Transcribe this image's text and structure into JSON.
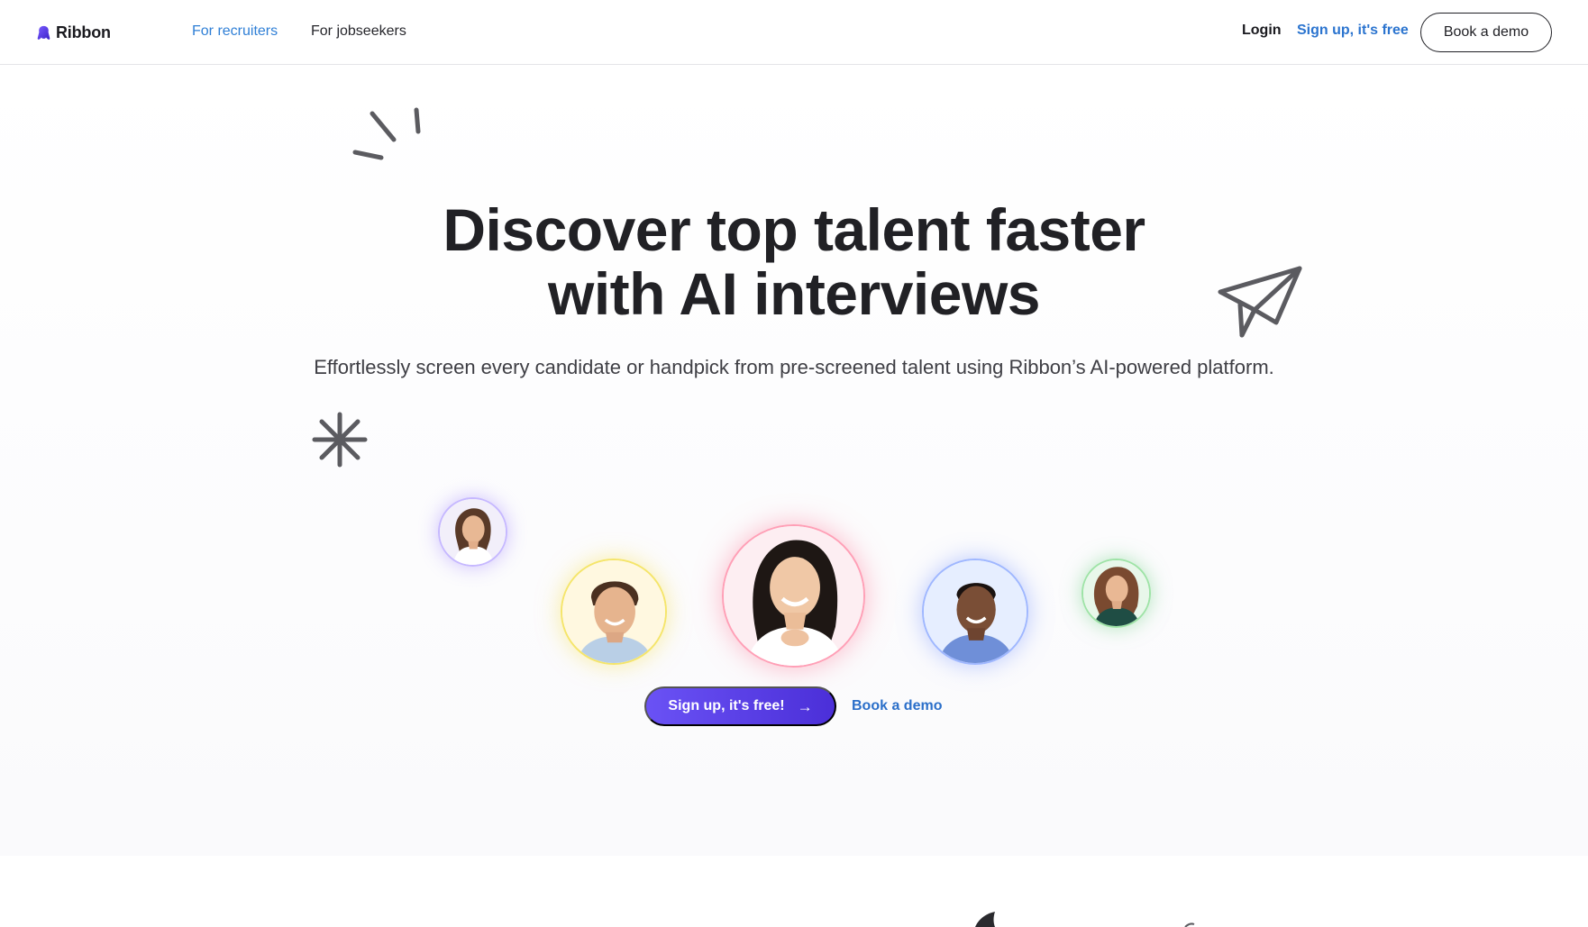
{
  "nav": {
    "brand": "Ribbon",
    "links": [
      {
        "label": "For recruiters",
        "active": true
      },
      {
        "label": "For jobseekers",
        "active": false
      }
    ],
    "login_label": "Login",
    "signup_label": "Sign up, it's free",
    "demo_label": "Book a demo"
  },
  "hero": {
    "title_line1": "Discover top talent faster",
    "title_line2": "with AI interviews",
    "subtitle": "Effortlessly screen every candidate or handpick from pre-screened talent using Ribbon’s AI-powered platform.",
    "primary_cta": "Sign up, it's free!",
    "primary_cta_icon": "arrow-right-icon",
    "secondary_cta": "Book a demo"
  },
  "avatars": [
    {
      "ring_color": "#c6b8ff"
    },
    {
      "ring_color": "#f5e56a"
    },
    {
      "ring_color": "#ff9fb6"
    },
    {
      "ring_color": "#9fb7ff"
    },
    {
      "ring_color": "#9ee3a6"
    }
  ],
  "icons": [
    "logo-icon",
    "sparkle-lines-icon",
    "paper-plane-icon",
    "asterisk-icon",
    "arrow-right-icon"
  ],
  "colors": {
    "accent": "#5a3ff0",
    "link_blue": "#2b74cf",
    "text_dark": "#1f1f24"
  }
}
